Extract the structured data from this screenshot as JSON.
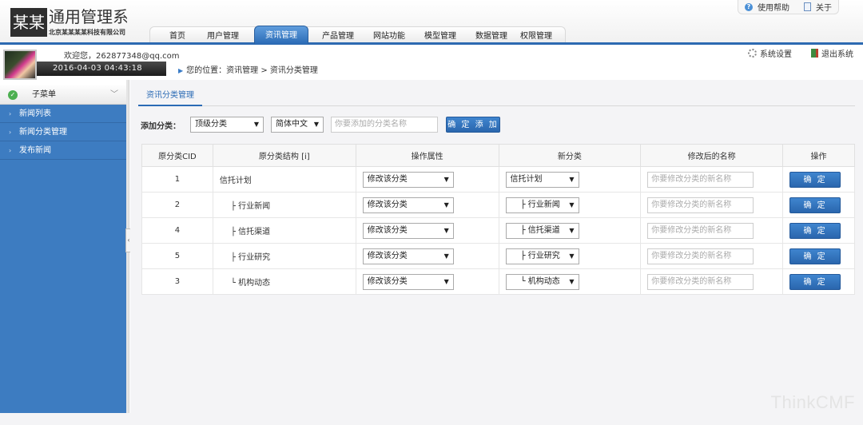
{
  "app": {
    "logo_text": "某某",
    "title": "通用管理系统",
    "company": "北京某某某某科技有限公司"
  },
  "top_links": {
    "help": "使用帮助",
    "about": "关于"
  },
  "nav": {
    "items": [
      "首页",
      "用户管理",
      "资讯管理",
      "产品管理",
      "网站功能",
      "模型管理",
      "数据管理",
      "权限管理"
    ],
    "active": "资讯管理"
  },
  "user": {
    "welcome": "欢迎您，262877348@qq.com",
    "datetime": "2016-04-03 04:43:18"
  },
  "breadcrumb": "您的位置：资讯管理 > 资讯分类管理",
  "sys": {
    "settings": "系统设置",
    "logout": "退出系统"
  },
  "sidebar": {
    "header": "子菜单",
    "items": [
      {
        "label": "新闻列表"
      },
      {
        "label": "新闻分类管理"
      },
      {
        "label": "发布新闻"
      }
    ]
  },
  "main": {
    "tab": "资讯分类管理",
    "add": {
      "label": "添加分类：",
      "level_select": "顶级分类",
      "lang_select": "简体中文",
      "name_placeholder": "你要添加的分类名称",
      "submit": "确 定 添 加"
    },
    "table": {
      "headers": [
        "原分类CID",
        "原分类结构 [i]",
        "操作属性",
        "新分类",
        "修改后的名称",
        "操作"
      ],
      "rows": [
        {
          "cid": "1",
          "structure": "信托计划",
          "op": "修改该分类",
          "newcat": "信托计划",
          "placeholder": "你要修改分类的新名称",
          "btn": "确 定"
        },
        {
          "cid": "2",
          "structure": "├ 行业新闻",
          "op": "修改该分类",
          "newcat": "├ 行业新闻",
          "placeholder": "你要修改分类的新名称",
          "btn": "确 定"
        },
        {
          "cid": "4",
          "structure": "├ 信托渠道",
          "op": "修改该分类",
          "newcat": "├ 信托渠道",
          "placeholder": "你要修改分类的新名称",
          "btn": "确 定"
        },
        {
          "cid": "5",
          "structure": "├ 行业研究",
          "op": "修改该分类",
          "newcat": "├ 行业研究",
          "placeholder": "你要修改分类的新名称",
          "btn": "确 定"
        },
        {
          "cid": "3",
          "structure": "└ 机构动态",
          "op": "修改该分类",
          "newcat": "└ 机构动态",
          "placeholder": "你要修改分类的新名称",
          "btn": "确 定"
        }
      ]
    }
  },
  "watermark": "ThinkCMF",
  "colors": {
    "accent": "#2b6bb5",
    "sidebar": "#3d7cc1"
  }
}
